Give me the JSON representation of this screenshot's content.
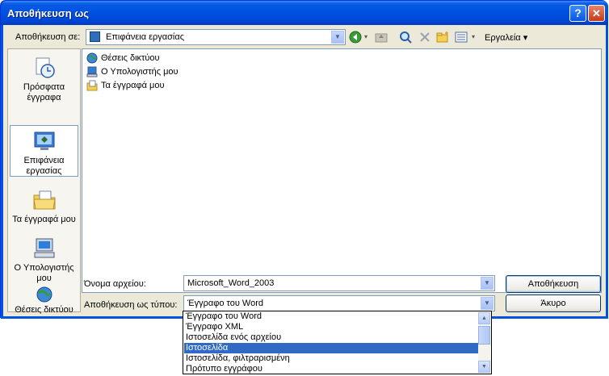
{
  "dialog": {
    "title": "Αποθήκευση ως",
    "help_glyph": "?",
    "close_glyph": "✕"
  },
  "lookin": {
    "label": "Αποθήκευση σε:",
    "value": "Επιφάνεια εργασίας",
    "arrow": "▼"
  },
  "toolbar": {
    "tools_label": "Εργαλεία ▾",
    "icons": [
      "back-icon",
      "up-folder-icon",
      "search-web-icon",
      "delete-icon",
      "new-folder-icon",
      "views-icon"
    ]
  },
  "places": [
    {
      "label": "Πρόσφατα έγγραφα",
      "icon": "recent-documents-icon"
    },
    {
      "label": "Επιφάνεια εργασίας",
      "icon": "desktop-icon"
    },
    {
      "label": "Τα έγγραφά μου",
      "icon": "my-documents-icon"
    },
    {
      "label": "Ο Υπολογιστής μου",
      "icon": "my-computer-icon"
    },
    {
      "label": "Θέσεις δικτύου",
      "icon": "network-places-icon"
    }
  ],
  "files": [
    {
      "name": "Θέσεις δικτύου",
      "icon": "network-places-icon"
    },
    {
      "name": "Ο Υπολογιστής μου",
      "icon": "my-computer-icon"
    },
    {
      "name": "Τα έγγραφά μου",
      "icon": "my-documents-icon"
    }
  ],
  "filename": {
    "label": "Όνομα αρχείου:",
    "value": "Microsoft_Word_2003"
  },
  "filetype": {
    "label": "Αποθήκευση ως τύπου:",
    "value": "Έγγραφο του Word",
    "options": [
      "Έγγραφο του Word",
      "Έγγραφο XML",
      "Ιστοσελίδα ενός αρχείου",
      "Ιστοσελίδα",
      "Ιστοσελίδα, φιλτραρισμένη",
      "Πρότυπο εγγράφου"
    ],
    "selected_option": "Ιστοσελίδα"
  },
  "buttons": {
    "save": "Αποθήκευση",
    "cancel": "Άκυρο"
  },
  "colors": {
    "titlebar": "#0054e3",
    "dialog_bg": "#ece9d8",
    "selection": "#316ac5"
  }
}
